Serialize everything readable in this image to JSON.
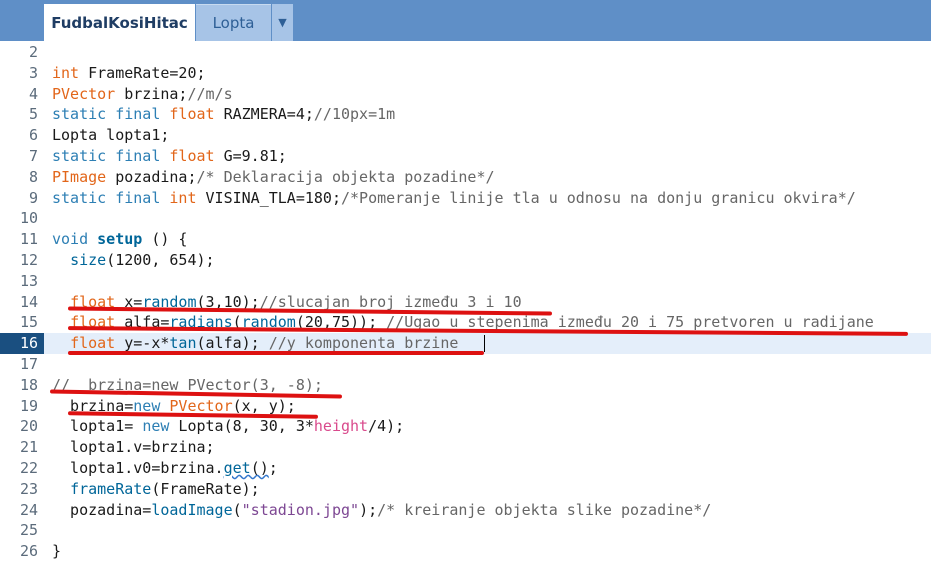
{
  "tabs": [
    {
      "label": "FudbalKosiHitac",
      "active": true
    },
    {
      "label": "Lopta",
      "active": false
    }
  ],
  "tab_menu_glyph": "▼",
  "colors": {
    "tabbar": "#5f8fc7",
    "keyword": "#2d7fb4",
    "type": "#e2661a",
    "comment": "#666666",
    "annotation": "#dd1111"
  },
  "editor": {
    "lines": [
      {
        "n": "2",
        "code": ""
      },
      {
        "n": "3",
        "code": "int FrameRate=20;"
      },
      {
        "n": "4",
        "code": "PVector brzina;//m/s"
      },
      {
        "n": "5",
        "code": "static final float RAZMERA=4;//10px=1m"
      },
      {
        "n": "6",
        "code": "Lopta lopta1;"
      },
      {
        "n": "7",
        "code": "static final float G=9.81;"
      },
      {
        "n": "8",
        "code": "PImage pozadina;/* Deklaracija objekta pozadine*/"
      },
      {
        "n": "9",
        "code": "static final int VISINA_TLA=180;/*Pomeranje linije tla u odnosu na donju granicu okvira*/"
      },
      {
        "n": "10",
        "code": ""
      },
      {
        "n": "11",
        "code": "void setup () {"
      },
      {
        "n": "12",
        "code": "  size(1200, 654);"
      },
      {
        "n": "13",
        "code": ""
      },
      {
        "n": "14",
        "code": "  float x=random(3,10);//slucajan broj između 3 i 10"
      },
      {
        "n": "15",
        "code": "  float alfa=radians(random(20,75)); //Ugao u stepenima između 20 i 75 pretvoren u radijane"
      },
      {
        "n": "16",
        "code": "  float y=-x*tan(alfa); //y komponenta brzine"
      },
      {
        "n": "17",
        "code": ""
      },
      {
        "n": "18",
        "code": "//  brzina=new PVector(3, -8);"
      },
      {
        "n": "19",
        "code": "  brzina=new PVector(x, y);"
      },
      {
        "n": "20",
        "code": "  lopta1= new Lopta(8, 30, 3*height/4);"
      },
      {
        "n": "21",
        "code": "  lopta1.v=brzina;"
      },
      {
        "n": "22",
        "code": "  lopta1.v0=brzina.get();"
      },
      {
        "n": "23",
        "code": "  frameRate(FrameRate);"
      },
      {
        "n": "24",
        "code": "  pozadina=loadImage(\"stadion.jpg\");/* kreiranje objekta slike pozadine*/"
      },
      {
        "n": "25",
        "code": ""
      },
      {
        "n": "26",
        "code": "}"
      }
    ],
    "current_line": "16"
  }
}
